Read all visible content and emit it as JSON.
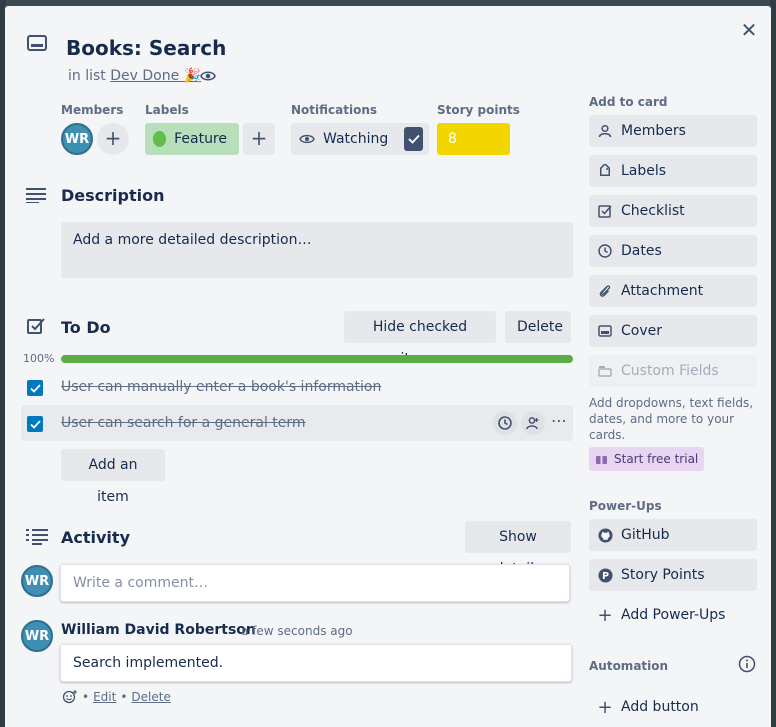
{
  "card": {
    "title": "Books: Search",
    "in_list_prefix": "in list",
    "list_name": "Dev Done 🎉",
    "close_icon": "close-icon"
  },
  "fields": {
    "members_label": "Members",
    "member_initials": "WR",
    "labels_label": "Labels",
    "label_feature": "Feature",
    "notifications_label": "Notifications",
    "watching": "Watching",
    "story_points_label": "Story points",
    "story_points_value": "8"
  },
  "description": {
    "title": "Description",
    "placeholder": "Add a more detailed description…"
  },
  "checklist": {
    "title": "To Do",
    "hide_checked": "Hide checked items",
    "delete": "Delete",
    "progress_text": "100%",
    "progress": 1.0,
    "items": [
      {
        "text": "User can manually enter a book's information",
        "checked": true
      },
      {
        "text": "User can search for a general term",
        "checked": true
      }
    ],
    "add_item": "Add an item"
  },
  "activity": {
    "title": "Activity",
    "show_details": "Show details",
    "comment_placeholder": "Write a comment…",
    "comment_author": "William David Robertson",
    "comment_time": "a few seconds ago",
    "comment_text": "Search implemented.",
    "edit": "Edit",
    "delete": "Delete",
    "sep": "•",
    "user_initials": "WR"
  },
  "sidebar": {
    "add_to_card": "Add to card",
    "buttons": [
      {
        "label": "Members",
        "icon": "person-icon"
      },
      {
        "label": "Labels",
        "icon": "tag-icon"
      },
      {
        "label": "Checklist",
        "icon": "checklist-icon"
      },
      {
        "label": "Dates",
        "icon": "clock-icon"
      },
      {
        "label": "Attachment",
        "icon": "paperclip-icon"
      },
      {
        "label": "Cover",
        "icon": "cover-icon"
      }
    ],
    "custom_fields": "Custom Fields",
    "custom_fields_help": "Add dropdowns, text fields, dates, and more to your cards.",
    "start_trial": "Start free trial",
    "power_ups_title": "Power-Ups",
    "power_ups": [
      {
        "label": "GitHub",
        "icon": "github-icon"
      },
      {
        "label": "Story Points",
        "icon": "story-points-icon"
      }
    ],
    "add_power_ups": "Add Power-Ups",
    "automation_title": "Automation",
    "add_button": "Add button"
  },
  "colors": {
    "label_green": "#61bd4f",
    "story_points_yellow": "#f2d600",
    "checkbox_blue": "#0079bf",
    "progress_green": "#5aac44",
    "avatar_blue": "#3f8fb3"
  }
}
